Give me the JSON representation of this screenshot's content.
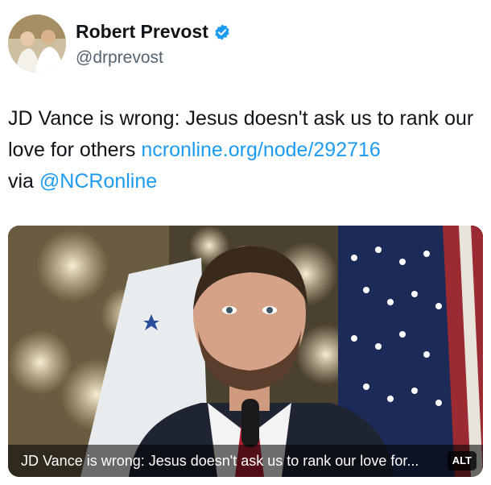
{
  "author": {
    "display_name": "Robert Prevost",
    "handle": "@drprevost",
    "verified_icon": "verified-badge-icon"
  },
  "tweet": {
    "text_before": "JD Vance is wrong: Jesus doesn't ask us to rank our love for others ",
    "link": "ncronline.org/node/292716",
    "via_text": " via ",
    "mention": "@NCRonline"
  },
  "media": {
    "caption": "JD Vance is wrong: Jesus doesn't ask us to rank our love for...",
    "alt_label": "ALT"
  },
  "colors": {
    "link": "#1d9bf0",
    "verified": "#1d9bf0",
    "handle": "#536471"
  }
}
